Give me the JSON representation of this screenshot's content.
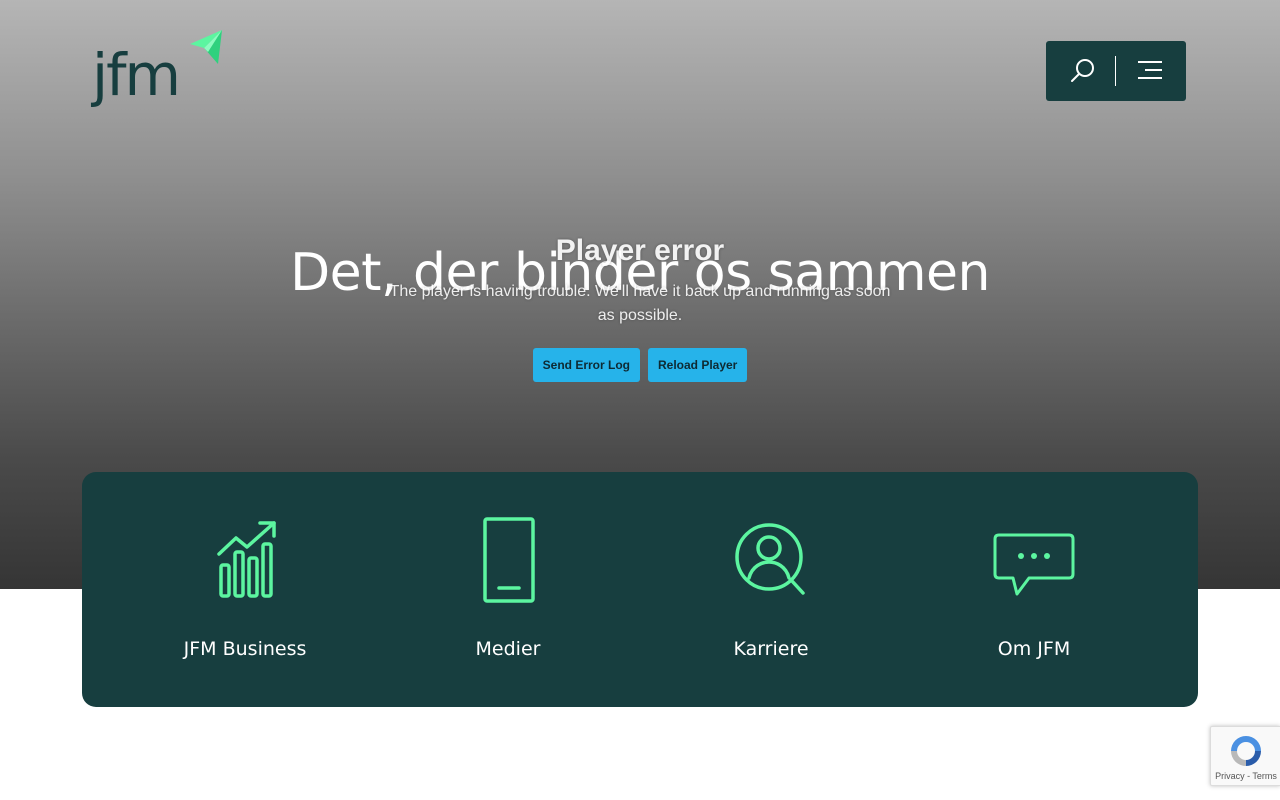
{
  "header": {
    "logo_text": "jfm",
    "brand_color": "#173e3f",
    "accent_color": "#5cf5a0",
    "search_icon": "search-icon",
    "menu_icon": "hamburger-menu-icon"
  },
  "hero": {
    "title": "Det, der binder os sammen"
  },
  "player_error": {
    "title": "Player error",
    "message": "The player is having trouble. We'll have it back up and running as soon as possible.",
    "send_log_label": "Send Error Log",
    "reload_label": "Reload Player",
    "button_color": "#26b3ea"
  },
  "features": [
    {
      "label": "JFM Business",
      "icon": "bar-chart-growth-icon"
    },
    {
      "label": "Medier",
      "icon": "mobile-phone-icon"
    },
    {
      "label": "Karriere",
      "icon": "person-search-icon"
    },
    {
      "label": "Om JFM",
      "icon": "chat-bubble-icon"
    }
  ],
  "recaptcha": {
    "links": "Privacy - Terms"
  }
}
